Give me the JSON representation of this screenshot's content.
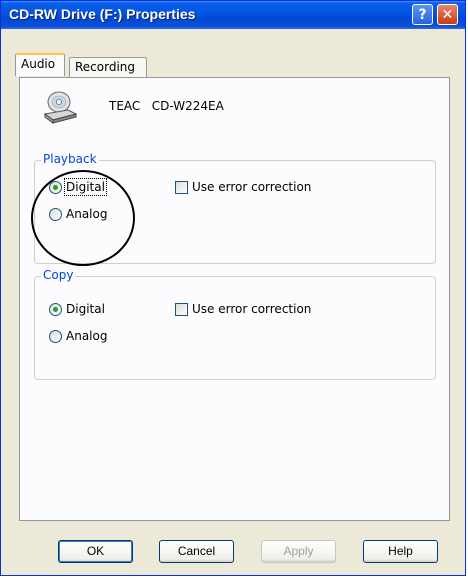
{
  "window": {
    "title": "CD-RW Drive (F:) Properties",
    "help_glyph": "?",
    "close_glyph": "✕"
  },
  "tabs": [
    {
      "label": "Audio",
      "active": true
    },
    {
      "label": "Recording",
      "active": false
    }
  ],
  "device": {
    "vendor": "TEAC",
    "model": "CD-W224EA",
    "icon": "cd-drive-icon"
  },
  "playback": {
    "legend": "Playback",
    "options": [
      {
        "label": "Digital",
        "checked": true
      },
      {
        "label": "Analog",
        "checked": false
      }
    ],
    "error_correction": {
      "label": "Use error correction",
      "checked": false
    }
  },
  "copy": {
    "legend": "Copy",
    "options": [
      {
        "label": "Digital",
        "checked": true
      },
      {
        "label": "Analog",
        "checked": false
      }
    ],
    "error_correction": {
      "label": "Use error correction",
      "checked": false
    }
  },
  "buttons": {
    "ok": "OK",
    "cancel": "Cancel",
    "apply": "Apply",
    "help": "Help"
  },
  "colors": {
    "titlebar": "#0353e2",
    "legend_text": "#0046d5",
    "radio_checked": "#21a121"
  }
}
